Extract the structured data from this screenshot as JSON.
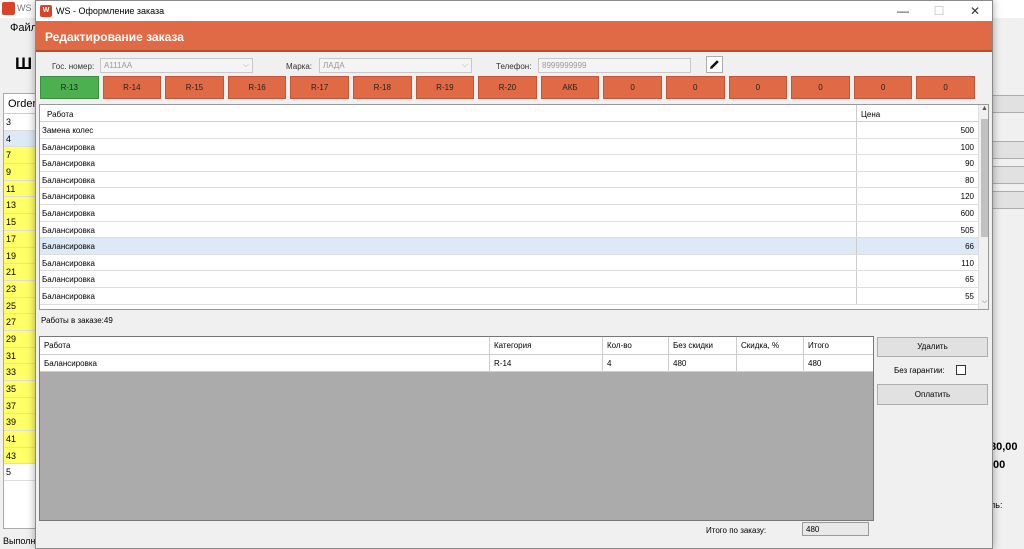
{
  "background": {
    "title": "WS",
    "menu": "Файл",
    "heading": "Ш",
    "list_header": "Order",
    "rows": [
      {
        "num": "3",
        "style": "white"
      },
      {
        "num": "4",
        "style": "sel"
      },
      {
        "num": "7",
        "style": "y"
      },
      {
        "num": "9",
        "style": "y"
      },
      {
        "num": "11",
        "style": "y"
      },
      {
        "num": "13",
        "style": "y"
      },
      {
        "num": "15",
        "style": "y"
      },
      {
        "num": "17",
        "style": "y"
      },
      {
        "num": "19",
        "style": "y"
      },
      {
        "num": "21",
        "style": "y"
      },
      {
        "num": "23",
        "style": "y"
      },
      {
        "num": "25",
        "style": "y"
      },
      {
        "num": "27",
        "style": "y"
      },
      {
        "num": "29",
        "style": "y"
      },
      {
        "num": "31",
        "style": "y"
      },
      {
        "num": "33",
        "style": "y"
      },
      {
        "num": "35",
        "style": "y"
      },
      {
        "num": "37",
        "style": "y"
      },
      {
        "num": "39",
        "style": "y"
      },
      {
        "num": "41",
        "style": "y"
      },
      {
        "num": "43",
        "style": "y"
      },
      {
        "num": "5",
        "style": "white"
      }
    ],
    "status": "Выполн",
    "right_value_1": "80,00",
    "right_value_2": ",00",
    "right_value_3": "ль:"
  },
  "dialog": {
    "title": "WS - Оформление заказа",
    "banner": "Редактирование заказа",
    "plate_label": "Гос. номер:",
    "plate_value": "А111АА",
    "brand_label": "Марка:",
    "brand_value": "ЛАДА",
    "phone_label": "Телефон:",
    "phone_value": "8999999999",
    "category_buttons": [
      "R-13",
      "R-14",
      "R-15",
      "R-16",
      "R-17",
      "R-18",
      "R-19",
      "R-20",
      "АКБ",
      "0",
      "0",
      "0",
      "0",
      "0",
      "0"
    ],
    "active_category": 0,
    "works_table": {
      "columns": [
        "Работа",
        "Цена"
      ],
      "selected_row": 7,
      "rows": [
        [
          "Замена колес",
          "500"
        ],
        [
          "Балансировка",
          "100"
        ],
        [
          "Балансировка",
          "90"
        ],
        [
          "Балансировка",
          "80"
        ],
        [
          "Балансировка",
          "120"
        ],
        [
          "Балансировка",
          "600"
        ],
        [
          "Балансировка",
          "505"
        ],
        [
          "Балансировка",
          "66"
        ],
        [
          "Балансировка",
          "110"
        ],
        [
          "Балансировка",
          "65"
        ],
        [
          "Балансировка",
          "55"
        ]
      ]
    },
    "works_count_label": "Работы в заказе:49",
    "order_table": {
      "columns": [
        "Работа",
        "Категория",
        "Кол-во",
        "Без скидки",
        "Скидка, %",
        "Итого"
      ],
      "rows": [
        [
          "Балансировка",
          "R-14",
          "4",
          "480",
          "",
          "480"
        ]
      ]
    },
    "delete_button": "Удалить",
    "no_warranty_label": "Без гарантии:",
    "no_warranty_checked": false,
    "pay_button": "Оплатить",
    "total_label": "Итого по заказу:",
    "total_value": "480",
    "colors": {
      "banner": "#e06a46",
      "category": "#e06a46",
      "active_category": "#4caf50",
      "selected_row": "#dde9f7"
    }
  }
}
